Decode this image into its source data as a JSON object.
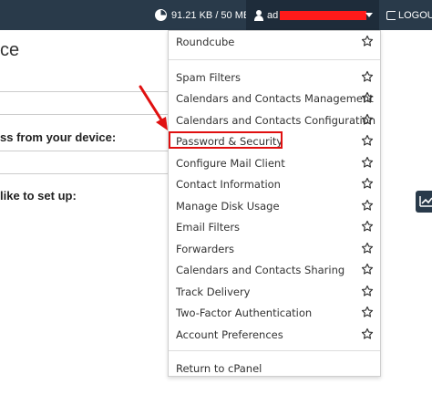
{
  "topbar": {
    "disk_usage": "91.21 KB / 50 MB",
    "username_visible": "ad",
    "logout_label": "LOGOUT"
  },
  "page": {
    "title_fragment": "ce",
    "device_label": "ss from your device:",
    "setup_label": " like to set up:"
  },
  "dropdown": {
    "top_item": "Roundcube",
    "items": [
      "Spam Filters",
      "Calendars and Contacts Management",
      "Calendars and Contacts Configuration",
      "Password & Security",
      "Configure Mail Client",
      "Contact Information",
      "Manage Disk Usage",
      "Email Filters",
      "Forwarders",
      "Calendars and Contacts Sharing",
      "Track Delivery",
      "Two-Factor Authentication",
      "Account Preferences"
    ],
    "return_label": "Return to cPanel"
  },
  "colors": {
    "topbar": "#293a4a",
    "user_menu": "#1e2c3a",
    "annotation_red": "#e01010"
  }
}
